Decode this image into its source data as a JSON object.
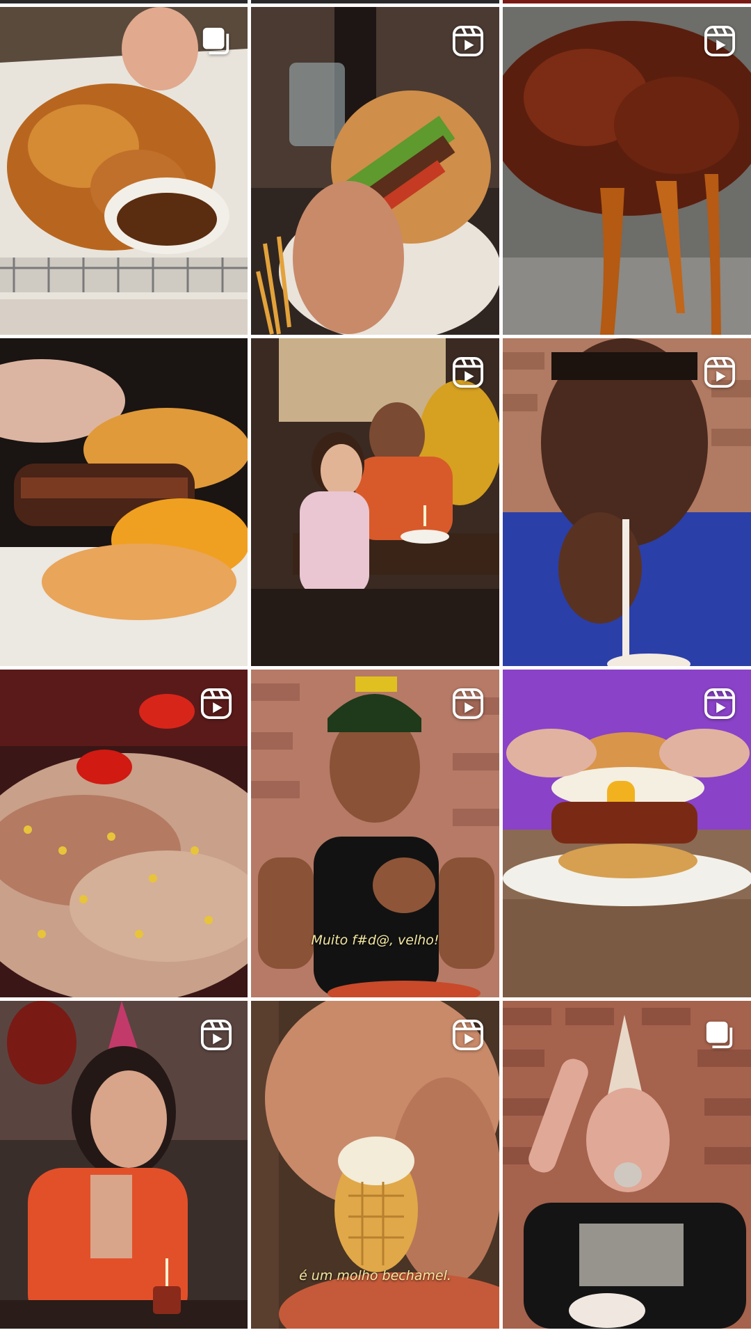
{
  "profile_grid": {
    "posts": [
      {
        "type": "carousel",
        "icon": "carousel-icon",
        "caption": ""
      },
      {
        "type": "reel",
        "icon": "reel-icon",
        "caption": ""
      },
      {
        "type": "reel",
        "icon": "reel-icon",
        "caption": ""
      },
      {
        "type": "photo",
        "icon": "",
        "caption": ""
      },
      {
        "type": "reel",
        "icon": "reel-icon",
        "caption": ""
      },
      {
        "type": "reel",
        "icon": "reel-icon",
        "caption": ""
      },
      {
        "type": "reel",
        "icon": "reel-icon",
        "caption": ""
      },
      {
        "type": "reel",
        "icon": "reel-icon",
        "caption": "Muito f#d@, velho!"
      },
      {
        "type": "reel",
        "icon": "reel-icon",
        "caption": ""
      },
      {
        "type": "reel",
        "icon": "reel-icon",
        "caption": ""
      },
      {
        "type": "reel",
        "icon": "reel-icon",
        "caption": "é um molho bechamel."
      },
      {
        "type": "carousel",
        "icon": "carousel-icon",
        "caption": ""
      }
    ],
    "colors": {
      "badge": "#ffffff",
      "caption_text": "#f3e7a0",
      "grid_gap": "#ffffff"
    }
  }
}
